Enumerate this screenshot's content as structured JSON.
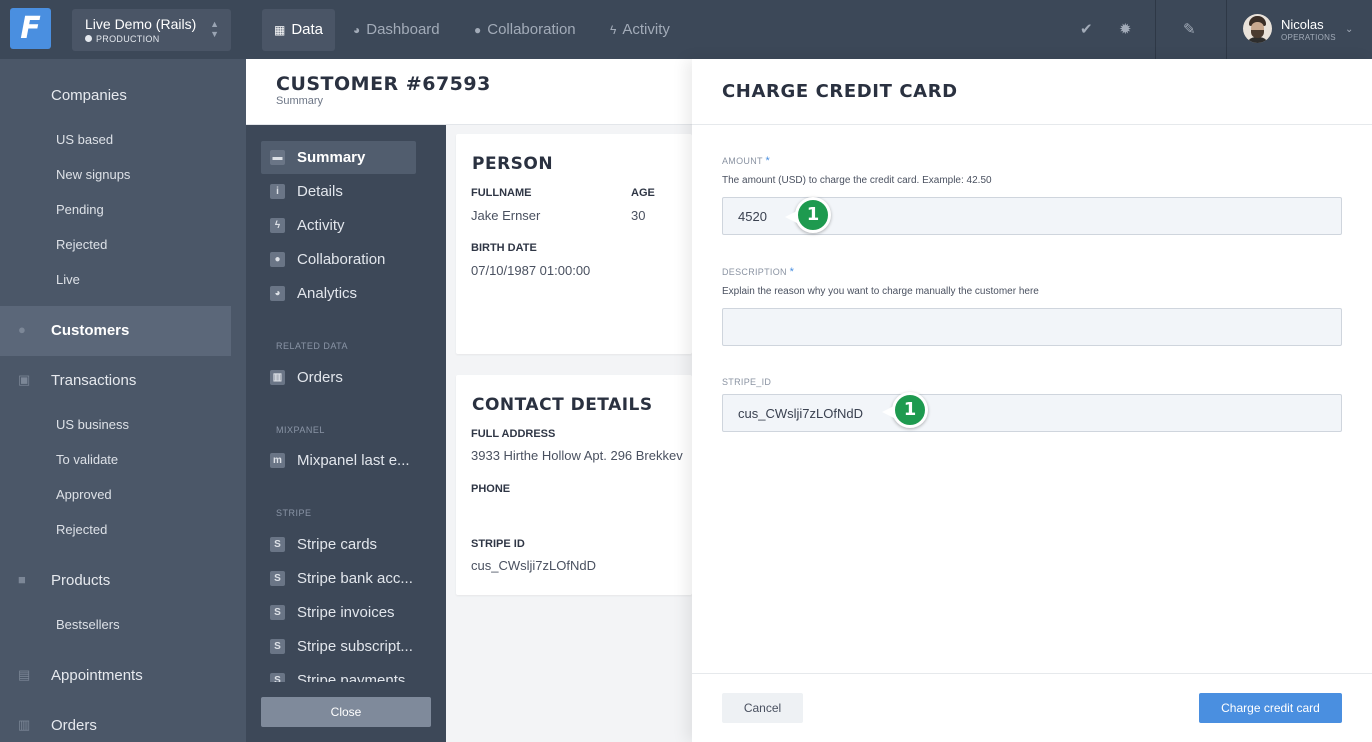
{
  "app": {
    "logo_letter": "F",
    "brand_color": "#4a8fe0"
  },
  "environment": {
    "name": "Live Demo (Rails)",
    "stage": "PRODUCTION"
  },
  "nav_tabs": [
    {
      "label": "Data",
      "icon": "table-icon",
      "active": true
    },
    {
      "label": "Dashboard",
      "icon": "dashboard-icon"
    },
    {
      "label": "Collaboration",
      "icon": "chat-icon"
    },
    {
      "label": "Activity",
      "icon": "bolt-icon"
    }
  ],
  "top_icons": [
    "check-icon",
    "gear-icon",
    "brush-icon"
  ],
  "user": {
    "name": "Nicolas",
    "role": "OPERATIONS"
  },
  "sidebar": {
    "companies": "Companies",
    "companies_segments": [
      "US based",
      "New signups",
      "Pending",
      "Rejected",
      "Live"
    ],
    "customers": "Customers",
    "transactions": "Transactions",
    "transactions_segments": [
      "US business",
      "To validate",
      "Approved",
      "Rejected"
    ],
    "products": "Products",
    "products_segments": [
      "Bestsellers"
    ],
    "appointments": "Appointments",
    "orders": "Orders"
  },
  "record": {
    "title": "CUSTOMER #67593",
    "subtitle": "Summary"
  },
  "record_nav": {
    "items": [
      "Summary",
      "Details",
      "Activity",
      "Collaboration",
      "Analytics"
    ],
    "related_title": "RELATED DATA",
    "related_items": [
      "Orders"
    ],
    "mixpanel_title": "MIXPANEL",
    "mixpanel_items": [
      "Mixpanel last e..."
    ],
    "stripe_title": "STRIPE",
    "stripe_items": [
      "Stripe cards",
      "Stripe bank acc...",
      "Stripe invoices",
      "Stripe subscript...",
      "Stripe payments"
    ],
    "close_label": "Close"
  },
  "person": {
    "title": "PERSON",
    "fullname_label": "FULLNAME",
    "fullname": "Jake Ernser",
    "age_label": "AGE",
    "age": "30",
    "birth_label": "BIRTH DATE",
    "birth": "07/10/1987 01:00:00"
  },
  "contact": {
    "title": "CONTACT DETAILS",
    "address_label": "FULL ADDRESS",
    "address": "3933 Hirthe Hollow Apt. 296 Brekkev",
    "phone_label": "PHONE",
    "phone": "",
    "stripe_label": "STRIPE ID",
    "stripe_id": "cus_CWslji7zLOfNdD"
  },
  "modal": {
    "title": "CHARGE CREDIT CARD",
    "amount_label": "AMOUNT",
    "amount_help": "The amount (USD) to charge the credit card. Example: 42.50",
    "amount_value": "4520",
    "description_label": "DESCRIPTION",
    "description_help": "Explain the reason why you want to charge manually the customer here",
    "description_value": "",
    "stripe_label": "STRIPE_ID",
    "stripe_value": "cus_CWslji7zLOfNdD",
    "required_mark": "*",
    "badge_text": "1",
    "cancel_label": "Cancel",
    "charge_label": "Charge credit card"
  }
}
